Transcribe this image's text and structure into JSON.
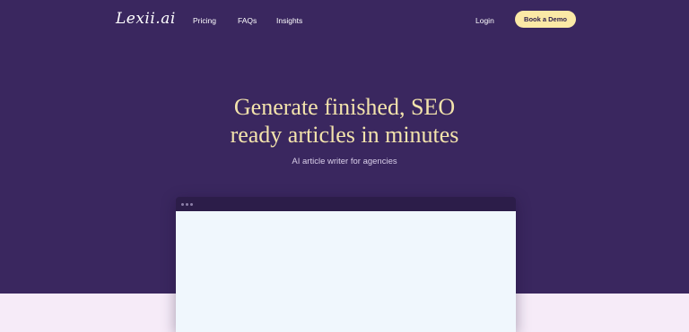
{
  "nav": {
    "logo_text": "Lexii.ai",
    "links": [
      {
        "label": "Pricing"
      },
      {
        "label": "FAQs"
      },
      {
        "label": "Insights"
      }
    ],
    "login_label": "Login",
    "cta_label": "Book a Demo"
  },
  "hero": {
    "headline_line1": "Generate finished, SEO",
    "headline_line2": "ready articles in minutes",
    "subtitle": "AI article writer for agencies"
  },
  "colors": {
    "hero_bg": "#3a275f",
    "below_bg": "#f6ebf8",
    "headline": "#f3e3ac",
    "cta_bg": "#fbe9a6",
    "browser_bar": "#2c1d49",
    "browser_body": "#f0f7fd"
  },
  "icons": {
    "browser_controls": [
      "window-dot-icon",
      "window-dot-icon",
      "window-dot-icon"
    ]
  }
}
